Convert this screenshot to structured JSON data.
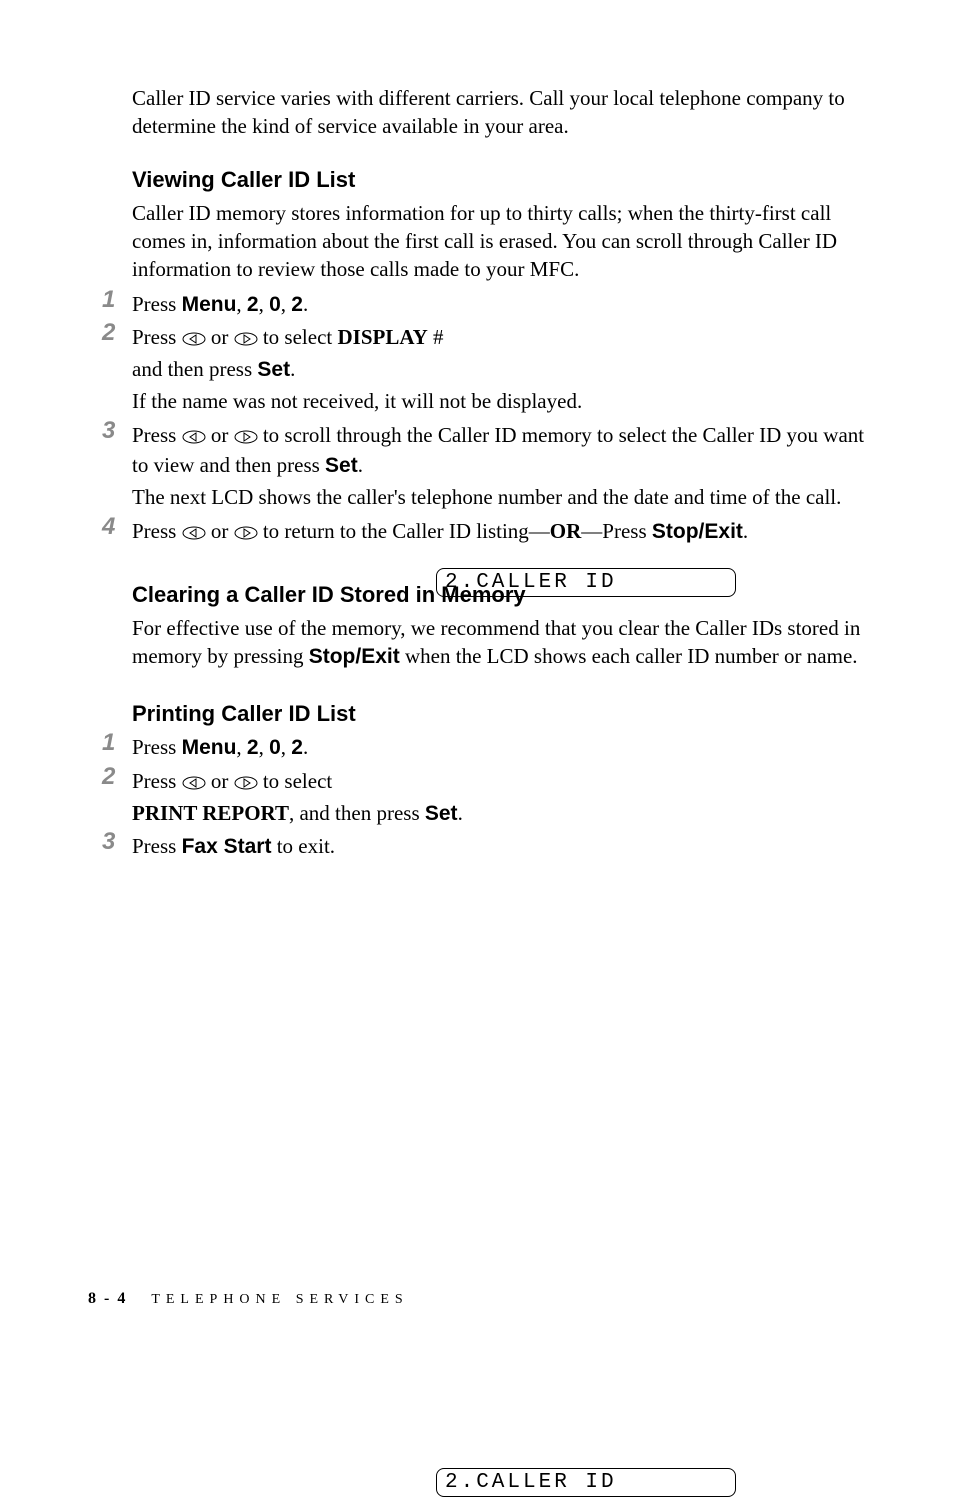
{
  "intro": "Caller ID service varies with different carriers.  Call your local telephone company to determine the kind of service available in your area.",
  "section1": {
    "title": "Viewing Caller ID List",
    "desc": "Caller ID memory stores information for up to thirty calls; when the thirty-first call comes in, information about the first call is erased.  You can scroll through Caller ID information to review those calls made to your MFC.",
    "steps": {
      "s1": {
        "num": "1",
        "pre": "Press ",
        "menu": "Menu",
        "after_menu": ", ",
        "k1": "2",
        "sep1": ", ",
        "k2": "0",
        "sep2": ", ",
        "k3": "2",
        "end": "."
      },
      "s2": {
        "num": "2",
        "pre": "Press ",
        "mid": " or ",
        "post1": " to select ",
        "display": "DISPLAY",
        "hash": " #",
        "line2_pre": "and then press ",
        "set": "Set",
        "line2_end": ".",
        "line3": "If the name was not received, it will not be displayed."
      },
      "s3": {
        "num": "3",
        "pre": "Press ",
        "mid": " or ",
        "post": " to scroll through the Caller ID memory to select the Caller ID you want to view and then press ",
        "set": "Set",
        "end": ".",
        "line2": "The next LCD shows the caller's telephone number and the date and time of the call."
      },
      "s4": {
        "num": "4",
        "pre": "Press ",
        "mid": " or ",
        "post": " to return to the Caller ID listing—",
        "or": "OR",
        "dash": "—Press ",
        "stop": "Stop/Exit",
        "end": "."
      }
    },
    "lcd": "2.CALLER ID"
  },
  "section2": {
    "title": "Clearing a Caller ID Stored in Memory",
    "para_pre": "For effective use of the memory, we recommend that you clear the Caller IDs stored in memory by pressing ",
    "stop": "Stop/Exit",
    "para_post": " when the LCD shows each caller ID number or name."
  },
  "section3": {
    "title": "Printing Caller ID List",
    "steps": {
      "s1": {
        "num": "1",
        "pre": "Press ",
        "menu": "Menu",
        "after_menu": ", ",
        "k1": "2",
        "sep1": ", ",
        "k2": "0",
        "sep2": ", ",
        "k3": "2",
        "end": "."
      },
      "s2": {
        "num": "2",
        "pre": "Press ",
        "mid": " or ",
        "post": " to select",
        "line2_pre": "PRINT REPORT",
        "line2_mid": ", and then press ",
        "set": "Set",
        "line2_end": "."
      },
      "s3": {
        "num": "3",
        "pre": "Press ",
        "fax": "Fax Start",
        "post": " to exit."
      }
    },
    "lcd": "2.CALLER ID"
  },
  "footer": {
    "page": "8 - 4",
    "chapter": "TELEPHONE SERVICES"
  }
}
